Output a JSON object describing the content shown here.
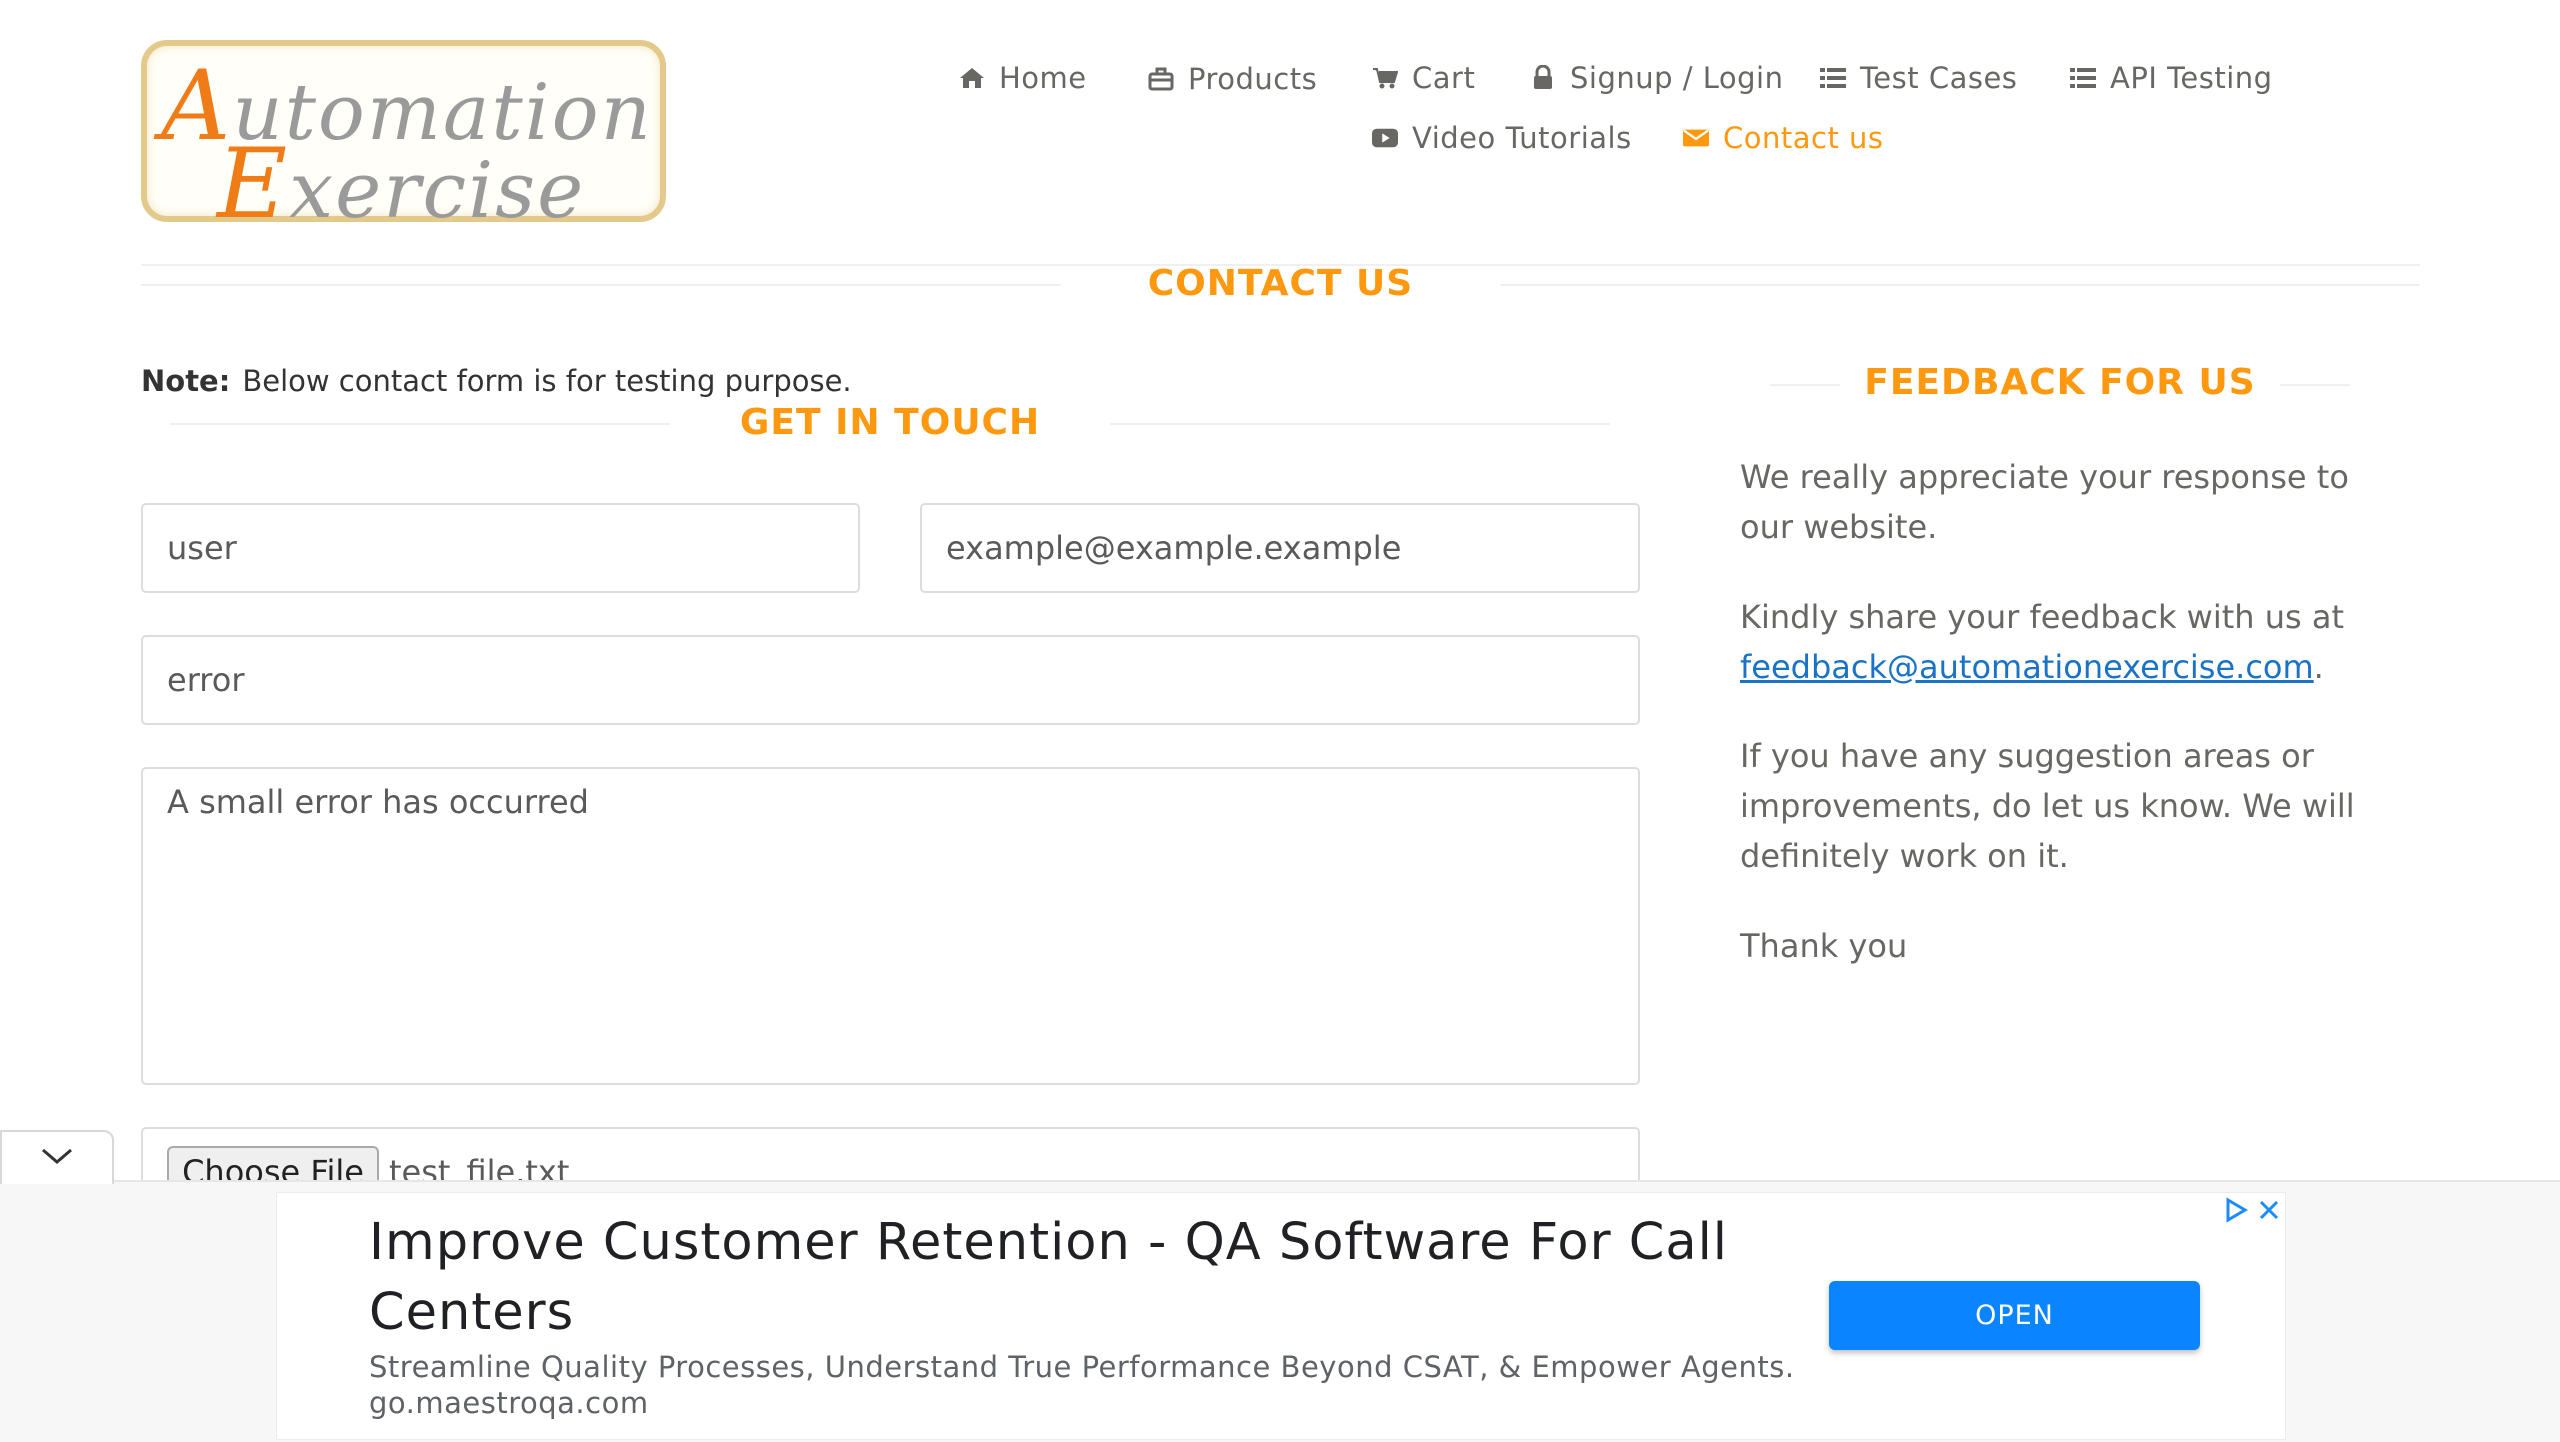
{
  "logo": {
    "line1": "Automation",
    "line2": "Exercise"
  },
  "nav": [
    {
      "label": "Home",
      "icon": "home-icon"
    },
    {
      "label": "Products",
      "icon": "briefcase-icon"
    },
    {
      "label": "Cart",
      "icon": "cart-icon"
    },
    {
      "label": "Signup / Login",
      "icon": "lock-icon"
    },
    {
      "label": "Test Cases",
      "icon": "list-icon"
    },
    {
      "label": "API Testing",
      "icon": "list-icon"
    },
    {
      "label": "Video Tutorials",
      "icon": "youtube-icon"
    },
    {
      "label": "Contact us",
      "icon": "envelope-icon",
      "active": true
    }
  ],
  "page_title": "CONTACT US",
  "note": {
    "label": "Note:",
    "text": "Below contact form is for testing purpose."
  },
  "form": {
    "title": "GET IN TOUCH",
    "name_value": "user",
    "email_value": "example@example.example",
    "subject_value": "error",
    "message_value": "A small error has occurred",
    "choose_file_label": "Choose File",
    "file_name": "test_file.txt"
  },
  "feedback": {
    "title": "FEEDBACK FOR US",
    "p1": "We really appreciate your response to our website.",
    "p2_prefix": "Kindly share your feedback with us at",
    "p2_email": "feedback@automationexercise.com",
    "p2_suffix": ".",
    "p3": "If you have any suggestion areas or improvements, do let us know. We will definitely work on it.",
    "p4": "Thank you"
  },
  "ad": {
    "headline": "Improve Customer Retention - QA Software For Call Centers",
    "description": "Streamline Quality Processes, Understand True Performance Beyond CSAT, & Empower Agents.",
    "url": "go.maestroqa.com",
    "cta": "OPEN"
  },
  "colors": {
    "accent": "#fe980f",
    "text": "#696763",
    "link": "#1a73c7",
    "ad_button": "#0a84ff"
  }
}
